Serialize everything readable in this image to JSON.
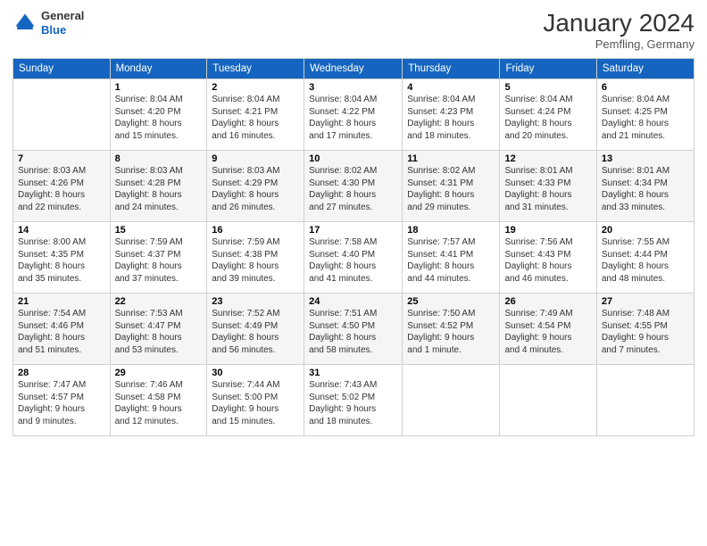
{
  "logo": {
    "general": "General",
    "blue": "Blue"
  },
  "title": "January 2024",
  "location": "Pemfling, Germany",
  "days_header": [
    "Sunday",
    "Monday",
    "Tuesday",
    "Wednesday",
    "Thursday",
    "Friday",
    "Saturday"
  ],
  "weeks": [
    [
      {
        "day": "",
        "sunrise": "",
        "sunset": "",
        "daylight": ""
      },
      {
        "day": "1",
        "sunrise": "Sunrise: 8:04 AM",
        "sunset": "Sunset: 4:20 PM",
        "daylight": "Daylight: 8 hours and 15 minutes."
      },
      {
        "day": "2",
        "sunrise": "Sunrise: 8:04 AM",
        "sunset": "Sunset: 4:21 PM",
        "daylight": "Daylight: 8 hours and 16 minutes."
      },
      {
        "day": "3",
        "sunrise": "Sunrise: 8:04 AM",
        "sunset": "Sunset: 4:22 PM",
        "daylight": "Daylight: 8 hours and 17 minutes."
      },
      {
        "day": "4",
        "sunrise": "Sunrise: 8:04 AM",
        "sunset": "Sunset: 4:23 PM",
        "daylight": "Daylight: 8 hours and 18 minutes."
      },
      {
        "day": "5",
        "sunrise": "Sunrise: 8:04 AM",
        "sunset": "Sunset: 4:24 PM",
        "daylight": "Daylight: 8 hours and 20 minutes."
      },
      {
        "day": "6",
        "sunrise": "Sunrise: 8:04 AM",
        "sunset": "Sunset: 4:25 PM",
        "daylight": "Daylight: 8 hours and 21 minutes."
      }
    ],
    [
      {
        "day": "7",
        "sunrise": "Sunrise: 8:03 AM",
        "sunset": "Sunset: 4:26 PM",
        "daylight": "Daylight: 8 hours and 22 minutes."
      },
      {
        "day": "8",
        "sunrise": "Sunrise: 8:03 AM",
        "sunset": "Sunset: 4:28 PM",
        "daylight": "Daylight: 8 hours and 24 minutes."
      },
      {
        "day": "9",
        "sunrise": "Sunrise: 8:03 AM",
        "sunset": "Sunset: 4:29 PM",
        "daylight": "Daylight: 8 hours and 26 minutes."
      },
      {
        "day": "10",
        "sunrise": "Sunrise: 8:02 AM",
        "sunset": "Sunset: 4:30 PM",
        "daylight": "Daylight: 8 hours and 27 minutes."
      },
      {
        "day": "11",
        "sunrise": "Sunrise: 8:02 AM",
        "sunset": "Sunset: 4:31 PM",
        "daylight": "Daylight: 8 hours and 29 minutes."
      },
      {
        "day": "12",
        "sunrise": "Sunrise: 8:01 AM",
        "sunset": "Sunset: 4:33 PM",
        "daylight": "Daylight: 8 hours and 31 minutes."
      },
      {
        "day": "13",
        "sunrise": "Sunrise: 8:01 AM",
        "sunset": "Sunset: 4:34 PM",
        "daylight": "Daylight: 8 hours and 33 minutes."
      }
    ],
    [
      {
        "day": "14",
        "sunrise": "Sunrise: 8:00 AM",
        "sunset": "Sunset: 4:35 PM",
        "daylight": "Daylight: 8 hours and 35 minutes."
      },
      {
        "day": "15",
        "sunrise": "Sunrise: 7:59 AM",
        "sunset": "Sunset: 4:37 PM",
        "daylight": "Daylight: 8 hours and 37 minutes."
      },
      {
        "day": "16",
        "sunrise": "Sunrise: 7:59 AM",
        "sunset": "Sunset: 4:38 PM",
        "daylight": "Daylight: 8 hours and 39 minutes."
      },
      {
        "day": "17",
        "sunrise": "Sunrise: 7:58 AM",
        "sunset": "Sunset: 4:40 PM",
        "daylight": "Daylight: 8 hours and 41 minutes."
      },
      {
        "day": "18",
        "sunrise": "Sunrise: 7:57 AM",
        "sunset": "Sunset: 4:41 PM",
        "daylight": "Daylight: 8 hours and 44 minutes."
      },
      {
        "day": "19",
        "sunrise": "Sunrise: 7:56 AM",
        "sunset": "Sunset: 4:43 PM",
        "daylight": "Daylight: 8 hours and 46 minutes."
      },
      {
        "day": "20",
        "sunrise": "Sunrise: 7:55 AM",
        "sunset": "Sunset: 4:44 PM",
        "daylight": "Daylight: 8 hours and 48 minutes."
      }
    ],
    [
      {
        "day": "21",
        "sunrise": "Sunrise: 7:54 AM",
        "sunset": "Sunset: 4:46 PM",
        "daylight": "Daylight: 8 hours and 51 minutes."
      },
      {
        "day": "22",
        "sunrise": "Sunrise: 7:53 AM",
        "sunset": "Sunset: 4:47 PM",
        "daylight": "Daylight: 8 hours and 53 minutes."
      },
      {
        "day": "23",
        "sunrise": "Sunrise: 7:52 AM",
        "sunset": "Sunset: 4:49 PM",
        "daylight": "Daylight: 8 hours and 56 minutes."
      },
      {
        "day": "24",
        "sunrise": "Sunrise: 7:51 AM",
        "sunset": "Sunset: 4:50 PM",
        "daylight": "Daylight: 8 hours and 58 minutes."
      },
      {
        "day": "25",
        "sunrise": "Sunrise: 7:50 AM",
        "sunset": "Sunset: 4:52 PM",
        "daylight": "Daylight: 9 hours and 1 minute."
      },
      {
        "day": "26",
        "sunrise": "Sunrise: 7:49 AM",
        "sunset": "Sunset: 4:54 PM",
        "daylight": "Daylight: 9 hours and 4 minutes."
      },
      {
        "day": "27",
        "sunrise": "Sunrise: 7:48 AM",
        "sunset": "Sunset: 4:55 PM",
        "daylight": "Daylight: 9 hours and 7 minutes."
      }
    ],
    [
      {
        "day": "28",
        "sunrise": "Sunrise: 7:47 AM",
        "sunset": "Sunset: 4:57 PM",
        "daylight": "Daylight: 9 hours and 9 minutes."
      },
      {
        "day": "29",
        "sunrise": "Sunrise: 7:46 AM",
        "sunset": "Sunset: 4:58 PM",
        "daylight": "Daylight: 9 hours and 12 minutes."
      },
      {
        "day": "30",
        "sunrise": "Sunrise: 7:44 AM",
        "sunset": "Sunset: 5:00 PM",
        "daylight": "Daylight: 9 hours and 15 minutes."
      },
      {
        "day": "31",
        "sunrise": "Sunrise: 7:43 AM",
        "sunset": "Sunset: 5:02 PM",
        "daylight": "Daylight: 9 hours and 18 minutes."
      },
      {
        "day": "",
        "sunrise": "",
        "sunset": "",
        "daylight": ""
      },
      {
        "day": "",
        "sunrise": "",
        "sunset": "",
        "daylight": ""
      },
      {
        "day": "",
        "sunrise": "",
        "sunset": "",
        "daylight": ""
      }
    ]
  ]
}
